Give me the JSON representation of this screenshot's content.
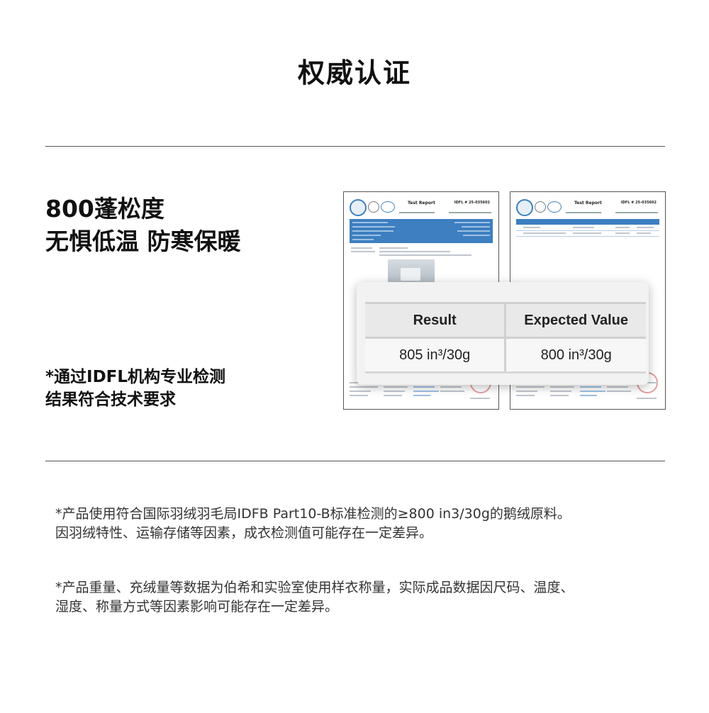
{
  "page": {
    "title": "权威认证"
  },
  "headline": {
    "line1": "800蓬松度",
    "line2": "无惧低温 防寒保暖"
  },
  "certification": {
    "line1": "*通过IDFL机构专业检测",
    "line2": "结果符合技术要求"
  },
  "reports": [
    {
      "title": "Test Report",
      "number": "IDFL # 25-035602"
    },
    {
      "title": "Test Report",
      "number": "IDFL # 25-035602"
    }
  ],
  "result_table": {
    "headers": [
      "Result",
      "Expected Value"
    ],
    "values": [
      "805 in³/30g",
      "800 in³/30g"
    ]
  },
  "disclaimers": [
    {
      "line1": "*产品使用符合国际羽绒羽毛局IDFB Part10-B标准检测的≥800 in3/30g的鹅绒原料。",
      "line2": "因羽绒特性、运输存储等因素，成衣检测值可能存在一定差异。"
    },
    {
      "line1": "*产品重量、充绒量等数据为伯希和实验室使用样衣称量，实际成品数据因尺码、温度、",
      "line2": "湿度、称量方式等因素影响可能存在一定差异。"
    }
  ],
  "colors": {
    "accent_blue": "#3d7fc0",
    "text": "#111111",
    "divider": "#555555"
  }
}
